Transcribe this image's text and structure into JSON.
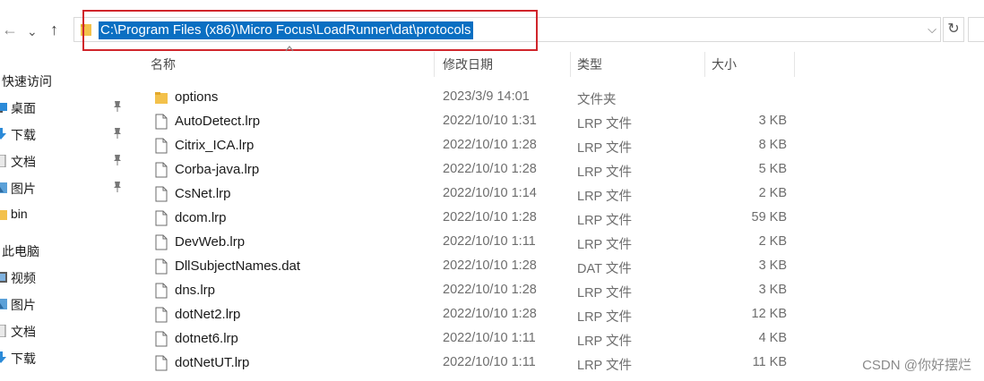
{
  "address_bar": {
    "path": "C:\\Program Files (x86)\\Micro Focus\\LoadRunner\\dat\\protocols"
  },
  "nav": {
    "back_icon": "arrow-left-icon",
    "forward_icon": "chevron-down-icon",
    "up_icon": "arrow-up-icon",
    "refresh_icon": "refresh-icon"
  },
  "columns": {
    "name": "名称",
    "date": "修改日期",
    "type": "类型",
    "size": "大小"
  },
  "sidebar": {
    "quick_access": "快速访问",
    "quick_items": [
      {
        "label": "桌面",
        "icon": "desktop-icon",
        "pinned": true
      },
      {
        "label": "下载",
        "icon": "download-icon",
        "pinned": true
      },
      {
        "label": "文档",
        "icon": "document-icon",
        "pinned": true
      },
      {
        "label": "图片",
        "icon": "picture-icon",
        "pinned": true
      },
      {
        "label": "bin",
        "icon": "folder-icon",
        "pinned": false
      }
    ],
    "this_pc": "此电脑",
    "pc_items": [
      {
        "label": "视频",
        "icon": "video-icon"
      },
      {
        "label": "图片",
        "icon": "picture-icon"
      },
      {
        "label": "文档",
        "icon": "document-icon"
      },
      {
        "label": "下载",
        "icon": "download-icon"
      }
    ]
  },
  "files": [
    {
      "name": "options",
      "date": "2023/3/9 14:01",
      "type": "文件夹",
      "size": "",
      "icon": "folder-icon"
    },
    {
      "name": "AutoDetect.lrp",
      "date": "2022/10/10 1:31",
      "type": "LRP 文件",
      "size": "3 KB",
      "icon": "file-icon"
    },
    {
      "name": "Citrix_ICA.lrp",
      "date": "2022/10/10 1:28",
      "type": "LRP 文件",
      "size": "8 KB",
      "icon": "file-icon"
    },
    {
      "name": "Corba-java.lrp",
      "date": "2022/10/10 1:28",
      "type": "LRP 文件",
      "size": "5 KB",
      "icon": "file-icon"
    },
    {
      "name": "CsNet.lrp",
      "date": "2022/10/10 1:14",
      "type": "LRP 文件",
      "size": "2 KB",
      "icon": "file-icon"
    },
    {
      "name": "dcom.lrp",
      "date": "2022/10/10 1:28",
      "type": "LRP 文件",
      "size": "59 KB",
      "icon": "file-icon"
    },
    {
      "name": "DevWeb.lrp",
      "date": "2022/10/10 1:11",
      "type": "LRP 文件",
      "size": "2 KB",
      "icon": "file-icon"
    },
    {
      "name": "DllSubjectNames.dat",
      "date": "2022/10/10 1:28",
      "type": "DAT 文件",
      "size": "3 KB",
      "icon": "file-icon"
    },
    {
      "name": "dns.lrp",
      "date": "2022/10/10 1:28",
      "type": "LRP 文件",
      "size": "3 KB",
      "icon": "file-icon"
    },
    {
      "name": "dotNet2.lrp",
      "date": "2022/10/10 1:28",
      "type": "LRP 文件",
      "size": "12 KB",
      "icon": "file-icon"
    },
    {
      "name": "dotnet6.lrp",
      "date": "2022/10/10 1:11",
      "type": "LRP 文件",
      "size": "4 KB",
      "icon": "file-icon"
    },
    {
      "name": "dotNetUT.lrp",
      "date": "2022/10/10 1:11",
      "type": "LRP 文件",
      "size": "11 KB",
      "icon": "file-icon"
    }
  ],
  "watermark": "CSDN @你好摆烂",
  "colors": {
    "selection": "#0a6fc2",
    "highlight_box": "#d0252b",
    "folder": "#f3c14b"
  }
}
